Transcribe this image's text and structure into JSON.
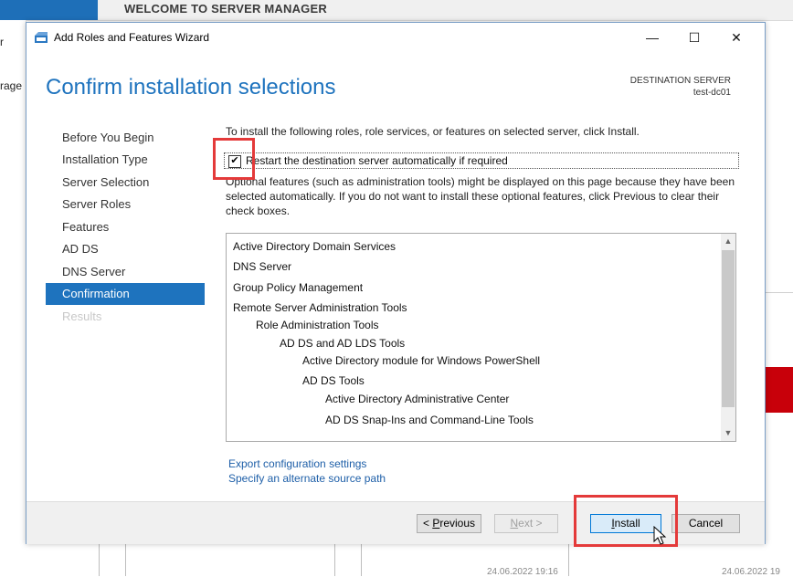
{
  "background": {
    "welcome_title": "WELCOME TO SERVER MANAGER",
    "sidebar_fragment_1": "r",
    "sidebar_fragment_2": "rage",
    "bottom_fragment_1": "24.06.2022 19:16",
    "bottom_fragment_2": "24.06.2022 19"
  },
  "wizard": {
    "window_title": "Add Roles and Features Wizard",
    "page_title": "Confirm installation selections",
    "destination_label": "DESTINATION SERVER",
    "destination_value": "test-dc01",
    "nav": [
      {
        "label": "Before You Begin",
        "state": "normal"
      },
      {
        "label": "Installation Type",
        "state": "normal"
      },
      {
        "label": "Server Selection",
        "state": "normal"
      },
      {
        "label": "Server Roles",
        "state": "normal"
      },
      {
        "label": "Features",
        "state": "normal"
      },
      {
        "label": "AD DS",
        "state": "normal"
      },
      {
        "label": "DNS Server",
        "state": "normal"
      },
      {
        "label": "Confirmation",
        "state": "active"
      },
      {
        "label": "Results",
        "state": "disabled"
      }
    ],
    "intro_text": "To install the following roles, role services, or features on selected server, click Install.",
    "restart_checkbox": {
      "label": "Restart the destination server automatically if required",
      "checked": true,
      "mark": "✔"
    },
    "optional_text": "Optional features (such as administration tools) might be displayed on this page because they have been selected automatically. If you do not want to install these optional features, click Previous to clear their check boxes.",
    "selections": [
      {
        "label": "Active Directory Domain Services",
        "level": 0
      },
      {
        "label": "DNS Server",
        "level": 0
      },
      {
        "label": "Group Policy Management",
        "level": 0
      },
      {
        "label": "Remote Server Administration Tools",
        "level": 0
      },
      {
        "label": "Role Administration Tools",
        "level": 1
      },
      {
        "label": "AD DS and AD LDS Tools",
        "level": 2
      },
      {
        "label": "Active Directory module for Windows PowerShell",
        "level": 3
      },
      {
        "label": "AD DS Tools",
        "level": 3
      },
      {
        "label": "Active Directory Administrative Center",
        "level": 4
      },
      {
        "label": "AD DS Snap-Ins and Command-Line Tools",
        "level": 4
      }
    ],
    "links": {
      "export": "Export configuration settings",
      "alternate_source": "Specify an alternate source path"
    },
    "buttons": {
      "previous_prefix": "< ",
      "previous_accel": "P",
      "previous_rest": "revious",
      "next_accel": "N",
      "next_rest": "ext >",
      "install_accel": "I",
      "install_rest": "nstall",
      "cancel": "Cancel"
    },
    "window_controls": {
      "minimize": "—",
      "maximize": "☐",
      "close": "✕"
    },
    "scroll": {
      "up": "▲",
      "down": "▼"
    }
  },
  "colors": {
    "accent": "#1e73be",
    "highlight": "#e43a3a",
    "link": "#1e5fa8"
  }
}
